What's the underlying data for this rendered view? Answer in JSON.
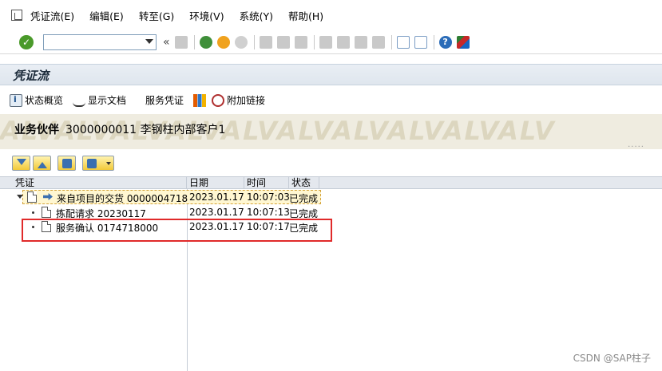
{
  "menu": {
    "items": [
      "凭证流(E)",
      "编辑(E)",
      "转至(G)",
      "环境(V)",
      "系统(Y)",
      "帮助(H)"
    ]
  },
  "toolbar": {
    "command_value": "",
    "nav_glyph": "«"
  },
  "title": "凭证流",
  "app_toolbar": {
    "status_overview": "状态概览",
    "show_document": "显示文档",
    "service_document": "服务凭证",
    "attach_link": "附加链接"
  },
  "header": {
    "partner_label": "业务伙伴",
    "partner_value": "3000000011 李钢柱内部客户1",
    "watermark": "ALVALVALVALVALVALVALVALVALVALV",
    "dots": "....."
  },
  "tree": {
    "columns": [
      "凭证",
      "日期",
      "时间",
      "状态"
    ],
    "rows": [
      {
        "doc": "来自项目的交货 0000004718",
        "date": "2023.01.17",
        "time": "10:07:03",
        "status": "已完成"
      },
      {
        "doc": "拣配请求 20230117",
        "date": "2023.01.17",
        "time": "10:07:13",
        "status": "已完成"
      },
      {
        "doc": "服务确认 0174718000",
        "date": "2023.01.17",
        "time": "10:07:17",
        "status": "已完成"
      }
    ]
  },
  "watermark": "CSDN @SAP柱子",
  "colors": {
    "highlight_box": "#e02a2a",
    "banner_bg": "#efece0",
    "title_bg": "#e4eaf1"
  }
}
